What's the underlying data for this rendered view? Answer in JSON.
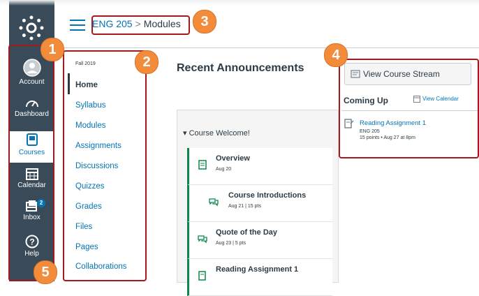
{
  "global_nav": {
    "items": [
      {
        "label": "Account",
        "icon": "account-icon"
      },
      {
        "label": "Dashboard",
        "icon": "dashboard-icon"
      },
      {
        "label": "Courses",
        "icon": "courses-icon",
        "active": true
      },
      {
        "label": "Calendar",
        "icon": "calendar-icon"
      },
      {
        "label": "Inbox",
        "icon": "inbox-icon",
        "badge": "2"
      },
      {
        "label": "Help",
        "icon": "help-icon"
      }
    ]
  },
  "breadcrumb": {
    "course": "ENG 205",
    "separator": ">",
    "page": "Modules"
  },
  "course_nav": {
    "term": "Fall 2019",
    "items": [
      "Home",
      "Syllabus",
      "Modules",
      "Assignments",
      "Discussions",
      "Quizzes",
      "Grades",
      "Files",
      "Pages",
      "Collaborations"
    ]
  },
  "main": {
    "heading": "Recent Announcements",
    "module": {
      "title": "Course Welcome!",
      "items": [
        {
          "title": "Overview",
          "meta": "Aug 20"
        },
        {
          "title": "Course Introductions",
          "meta": "Aug 21 | 15 pts"
        },
        {
          "title": "Quote of the Day",
          "meta": "Aug 23 | 5 pts"
        },
        {
          "title": "Reading Assignment 1",
          "meta": ""
        }
      ]
    }
  },
  "sidebar": {
    "stream_button": "View Course Stream",
    "coming_up": "Coming Up",
    "view_calendar": "View Calendar",
    "todo": {
      "title": "Reading Assignment 1",
      "course": "ENG 205",
      "meta": "15 points • Aug 27 at 8pm"
    }
  },
  "callouts": [
    "1",
    "2",
    "3",
    "4",
    "5"
  ],
  "colors": {
    "nav_bg": "#394b58",
    "link": "#0374b5",
    "callout": "#f28c3b",
    "callout_border": "#a3191d",
    "module_bar": "#0b874b"
  }
}
